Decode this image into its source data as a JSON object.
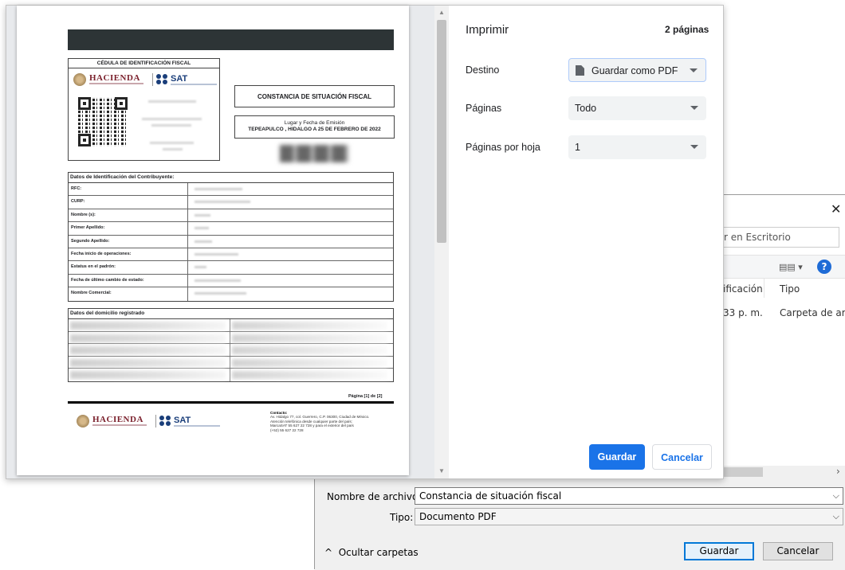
{
  "print": {
    "title": "Imprimir",
    "page_count": "2 páginas",
    "destination_label": "Destino",
    "destination_value": "Guardar como PDF",
    "pages_label": "Páginas",
    "pages_value": "Todo",
    "pages_per_sheet_label": "Páginas por hoja",
    "pages_per_sheet_value": "1",
    "save_button": "Guardar",
    "cancel_button": "Cancelar"
  },
  "document": {
    "cedula_title": "CÉDULA DE IDENTIFICACIÓN FISCAL",
    "hacienda": "HACIENDA",
    "sat": "SAT",
    "constancia_title": "CONSTANCIA DE SITUACIÓN FISCAL",
    "lugar_label": "Lugar y Fecha de Emisión",
    "lugar_value": "TEPEAPULCO , HIDALGO A 25 DE FEBRERO DE 2022",
    "ident_section": "Datos de Identificación del Contribuyente:",
    "ident_fields": [
      "RFC:",
      "CURP:",
      "Nombre (s):",
      "Primer Apellido:",
      "Segundo Apellido:",
      "Fecha inicio de operaciones:",
      "Estatus en el padrón:",
      "Fecha de último cambio de estado:",
      "Nombre Comercial:"
    ],
    "domicilio_section": "Datos del domicilio registrado",
    "pagina": "Página [1] de [2]",
    "contact_title": "Contacto:",
    "contact_lines": [
      "Av. Hidalgo 77, col. Guerrero, C.P. 06300, Ciudad de México.",
      "Atención telefónica desde cualquier parte del país:",
      "MarcaSAT 55 627 22 728 y para el exterior del país",
      "(+52) 55 627 22 728"
    ]
  },
  "save_dialog": {
    "search_placeholder": "car en Escritorio",
    "col_modified": "ificación",
    "col_type": "Tipo",
    "row_time": "33 p. m.",
    "row_type": "Carpeta de arch",
    "filename_label": "Nombre de archivo:",
    "filename_value": "Constancia de situación fiscal",
    "type_label": "Tipo:",
    "type_value": "Documento PDF",
    "hide_folders": "Ocultar carpetas",
    "save_button": "Guardar",
    "cancel_button": "Cancelar"
  },
  "colors": {
    "accent": "#1a73e8",
    "windows_focus": "#0078d7"
  }
}
